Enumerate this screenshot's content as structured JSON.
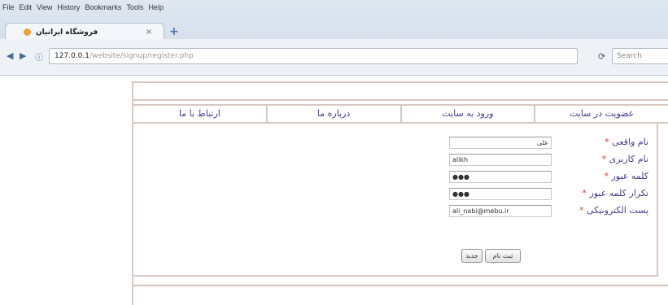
{
  "browser": {
    "menu": [
      "File",
      "Edit",
      "View",
      "History",
      "Bookmarks",
      "Tools",
      "Help"
    ],
    "tab_title": "فروشگاه ایرانیان",
    "tab_close": "×",
    "new_tab": "+",
    "url_host": "127.0.0.1",
    "url_path": "/website/signup/register.php",
    "search_placeholder": "Search",
    "back": "◀",
    "forward": "▶",
    "reload": "⟳",
    "info": "ⓘ"
  },
  "site": {
    "nav": [
      "عضویت در سایت",
      "ورود به سایت",
      "درباره ما",
      "ارتباط با ما"
    ]
  },
  "form": {
    "fields": [
      {
        "label": "نام واقعی",
        "required": "*",
        "value": "علی"
      },
      {
        "label": "نام کاربری",
        "required": "*",
        "value": "alikh"
      },
      {
        "label": "کلمه عبور",
        "required": "*",
        "value": "●●●"
      },
      {
        "label": "تکرار کلمه عبور",
        "required": "*",
        "value": "●●●"
      },
      {
        "label": "پست الکترونیکی",
        "required": "*",
        "value": "ali_nabi@mebu.ir"
      }
    ],
    "submit_label": "ثبت نام",
    "reset_label": "جدید"
  }
}
